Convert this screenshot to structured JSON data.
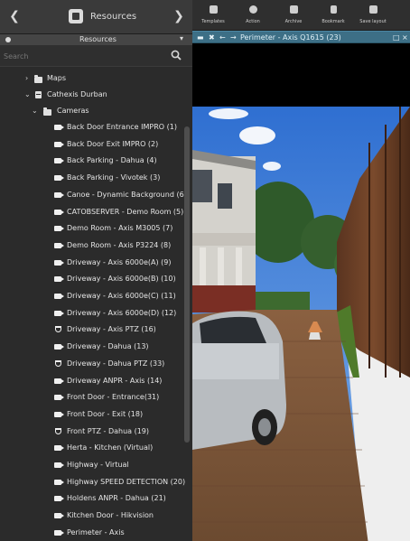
{
  "nav": {
    "back_icon": "chevron-left",
    "resources_icon": "cube-icon",
    "title": "Resources",
    "forward_icon": "chevron-right"
  },
  "subbar": {
    "title": "Resources"
  },
  "search": {
    "placeholder": "Search",
    "icon": "search-icon"
  },
  "tree": {
    "maps": "Maps",
    "site": "Cathexis Durban",
    "cameras_folder": "Cameras",
    "cameras": [
      {
        "label": "Back Door Entrance IMPRO (1)",
        "type": "camera"
      },
      {
        "label": "Back Door Exit IMPRO (2)",
        "type": "camera"
      },
      {
        "label": "Back Parking - Dahua (4)",
        "type": "camera"
      },
      {
        "label": "Back Parking - Vivotek (3)",
        "type": "camera"
      },
      {
        "label": "Canoe - Dynamic Background (6",
        "type": "camera"
      },
      {
        "label": "CATOBSERVER - Demo Room (5)",
        "type": "camera"
      },
      {
        "label": "Demo Room - Axis M3005 (7)",
        "type": "camera"
      },
      {
        "label": "Demo Room - Axis P3224 (8)",
        "type": "camera"
      },
      {
        "label": "Driveway - Axis 6000e(A) (9)",
        "type": "camera"
      },
      {
        "label": "Driveway - Axis 6000e(B) (10)",
        "type": "camera"
      },
      {
        "label": "Driveway - Axis 6000e(C) (11)",
        "type": "camera"
      },
      {
        "label": "Driveway - Axis 6000e(D) (12)",
        "type": "camera"
      },
      {
        "label": "Driveway - Axis PTZ (16)",
        "type": "ptz"
      },
      {
        "label": "Driveway - Dahua (13)",
        "type": "camera"
      },
      {
        "label": "Driveway - Dahua PTZ (33)",
        "type": "ptz"
      },
      {
        "label": "Driveway ANPR - Axis (14)",
        "type": "camera"
      },
      {
        "label": "Front Door - Entrance(31)",
        "type": "camera"
      },
      {
        "label": "Front Door - Exit (18)",
        "type": "camera"
      },
      {
        "label": "Front PTZ - Dahua (19)",
        "type": "ptz"
      },
      {
        "label": "Herta - Kitchen (Virtual)",
        "type": "camera"
      },
      {
        "label": "Highway - Virtual",
        "type": "camera"
      },
      {
        "label": "Highway SPEED DETECTION (20)",
        "type": "camera"
      },
      {
        "label": "Holdens  ANPR - Dahua (21)",
        "type": "camera"
      },
      {
        "label": "Kitchen Door - Hikvision",
        "type": "camera"
      },
      {
        "label": "Perimeter - Axis",
        "type": "camera"
      },
      {
        "label": "Perimeter - Axis Q1615 (23)",
        "type": "ptz",
        "selected": true
      }
    ]
  },
  "toolbar": {
    "buttons": [
      {
        "label": "Templates",
        "icon": "grid-icon"
      },
      {
        "label": "Action",
        "icon": "target-icon"
      },
      {
        "label": "Archive",
        "icon": "archive-icon"
      },
      {
        "label": "Bookmark",
        "icon": "bookmark-icon"
      },
      {
        "label": "Save layout",
        "icon": "save-icon"
      }
    ]
  },
  "view": {
    "title": "Perimeter - Axis Q1615 (23)",
    "accent": "#3d6f86",
    "selection_color": "#7dc23a"
  }
}
